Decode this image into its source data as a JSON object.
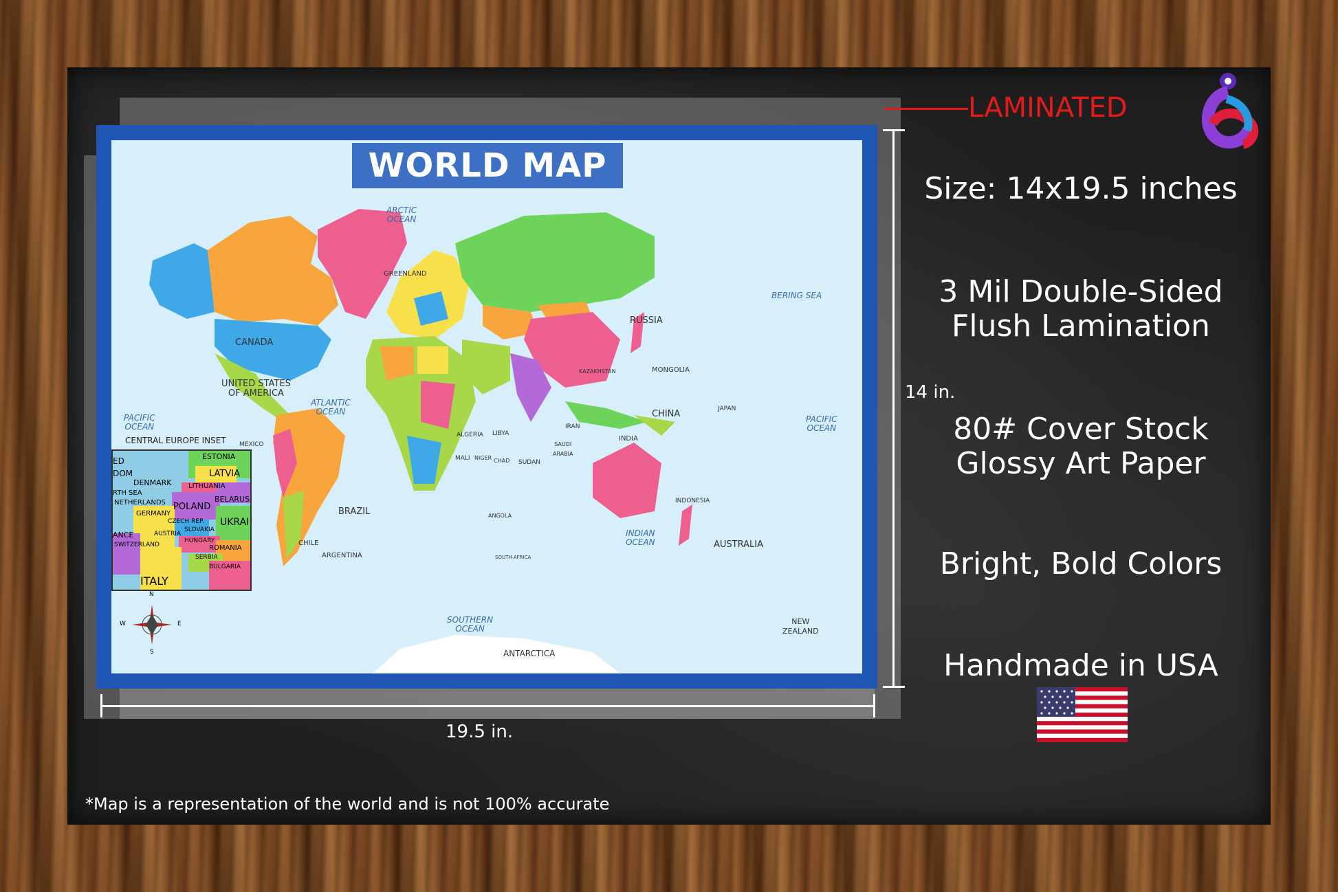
{
  "map": {
    "title": "WORLD MAP",
    "oceans": {
      "arctic": "ARCTIC\nOCEAN",
      "atlantic": "ATLANTIC\nOCEAN",
      "pacific_west": "PACIFIC\nOCEAN",
      "pacific_east": "PACIFIC\nOCEAN",
      "indian": "INDIAN\nOCEAN",
      "southern": "SOUTHERN\nOCEAN",
      "bering": "BERING SEA"
    },
    "countries": {
      "canada": "CANADA",
      "usa": "UNITED STATES\nOF AMERICA",
      "greenland": "GREENLAND",
      "russia": "RUSSIA",
      "china": "CHINA",
      "mongolia": "MONGOLIA",
      "kazakhstan": "KAZAKHSTAN",
      "india": "INDIA",
      "brazil": "BRAZIL",
      "argentina": "ARGENTINA",
      "chile": "CHILE",
      "australia": "AUSTRALIA",
      "algeria": "ALGERIA",
      "libya": "LIBYA",
      "sudan": "SUDAN",
      "mali": "MALI",
      "niger": "NIGER",
      "chad": "CHAD",
      "japan": "JAPAN",
      "indonesia": "INDONESIA",
      "antarctica": "ANTARCTICA",
      "new_zealand": "NEW\nZEALAND",
      "mexico": "MEXICO",
      "iran": "IRAN",
      "saudi": "SAUDI\nARABIA",
      "angola": "ANGOLA",
      "south_africa": "SOUTH AFRICA"
    },
    "inset": {
      "title": "CENTRAL EUROPE INSET",
      "labels": [
        "ESTONIA",
        "LATVIA",
        "DENMARK",
        "LITHUANIA",
        "NETHERLANDS",
        "BELARUS",
        "POLAND",
        "GERMANY",
        "CZECH REP.",
        "UKRAI",
        "SLOVAKIA",
        "AUSTRIA",
        "HUNGARY",
        "SWITZERLAND",
        "ROMANIA",
        "SERBIA",
        "BULGARIA",
        "ITALY",
        "ANCE",
        "ED",
        "DOM",
        "RTH SEA"
      ]
    },
    "compass": {
      "n": "N",
      "s": "S",
      "e": "E",
      "w": "W"
    }
  },
  "dimensions": {
    "height": "14 in.",
    "width": "19.5 in."
  },
  "laminated_label": "LAMINATED",
  "specs": {
    "size": "Size: 14x19.5 inches",
    "lamination": "3 Mil Double-Sided\nFlush Lamination",
    "paper": "80# Cover Stock\nGlossy Art Paper",
    "colors": "Bright, Bold Colors",
    "made": "Handmade in USA"
  },
  "footnote": "*Map is a representation of the world and is not 100% accurate",
  "colors": {
    "poster_border": "#1f56b3",
    "ocean": "#d6effa",
    "accent_red": "#e11b1b",
    "board": "#1f1f1f"
  },
  "icons": {
    "logo": "brand-logo",
    "flag": "usa-flag-icon",
    "compass": "compass-rose-icon"
  }
}
